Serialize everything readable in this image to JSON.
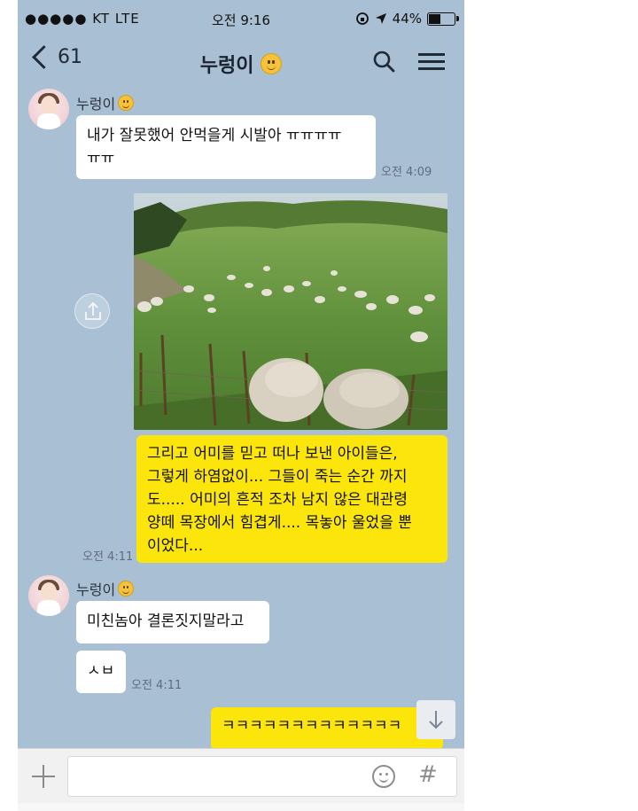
{
  "status_bar": {
    "carrier": "●●●●● KT  LTE",
    "time": "오전 9:16",
    "battery": "44%",
    "battery_level": 0.44
  },
  "header": {
    "back_count": "61",
    "title": "누렁이",
    "search_icon": "search-icon",
    "menu_icon": "menu-icon"
  },
  "messages": [
    {
      "sender": "누렁이",
      "text_line1": "내가 잘못했어 안먹을게 시발아 ㅠㅠㅠㅠ",
      "text_line2": "ㅠㅠ",
      "time": "오전 4:09"
    },
    {
      "type": "image",
      "description_icon": "share-icon"
    },
    {
      "text_lines": [
        "그리고 어미를 믿고 떠나 보낸 아이들은,",
        "그렇게 하염없이... 그들이 죽는 순간 까지",
        "도..... 어미의 흔적 조차 남지 않은 대관령",
        "양떼 목장에서 힘겹게.... 목놓아 울었을 뿐",
        "이었다..."
      ],
      "time": "오전 4:11"
    },
    {
      "sender": "누렁이",
      "text": "미친놈아 결론짓지말라고"
    },
    {
      "text": "ㅅㅂ",
      "time": "오전 4:11"
    },
    {
      "text": "ㅋㅋㅋㅋㅋㅋㅋㅋㅋㅋㅋㅋㅋ"
    }
  ],
  "input_bar": {
    "placeholder": "",
    "hash_label": "#"
  },
  "colors": {
    "chat_background": "#a9bfd3",
    "my_bubble": "#fbe50b",
    "their_bubble": "#ffffff"
  }
}
